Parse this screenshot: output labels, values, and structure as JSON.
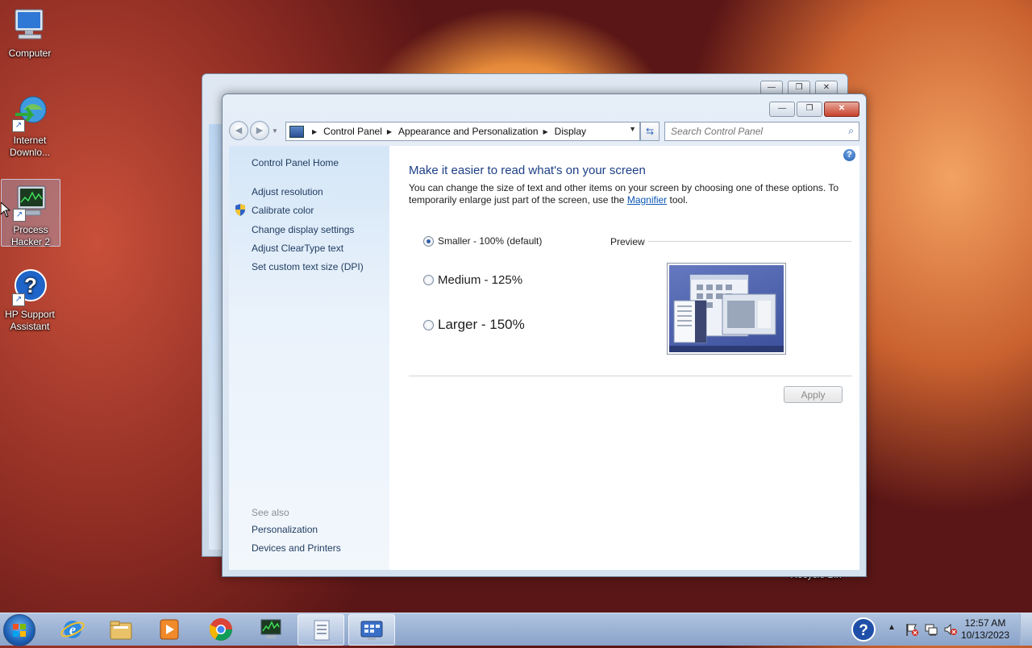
{
  "desktop": {
    "icons": [
      {
        "label": "Computer"
      },
      {
        "label": "Internet Downlo..."
      },
      {
        "label": "Process Hacker 2"
      },
      {
        "label": "HP Support Assistant"
      },
      {
        "label": "Recycle Bin"
      }
    ]
  },
  "window": {
    "caption": {
      "minimize": "—",
      "maximize": "❐",
      "close": "✕"
    },
    "address": {
      "crumbs": [
        "Control Panel",
        "Appearance and Personalization",
        "Display"
      ]
    },
    "search": {
      "placeholder": "Search Control Panel"
    },
    "left_pane": {
      "home": "Control Panel Home",
      "links": [
        "Adjust resolution",
        "Calibrate color",
        "Change display settings",
        "Adjust ClearType text",
        "Set custom text size (DPI)"
      ],
      "see_also": "See also",
      "see_also_links": [
        "Personalization",
        "Devices and Printers"
      ]
    },
    "main": {
      "title": "Make it easier to read what's on your screen",
      "desc_1": "You can change the size of text and other items on your screen by choosing one of these options. To temporarily enlarge just part of the screen, use the",
      "magnifier_link": "Magnifier",
      "desc_2": "tool.",
      "options": [
        {
          "label": "Smaller - 100% (default)",
          "checked": true
        },
        {
          "label": "Medium - 125%",
          "checked": false
        },
        {
          "label": "Larger - 150%",
          "checked": false
        }
      ],
      "preview_label": "Preview",
      "apply_label": "Apply"
    }
  },
  "taskbar": {
    "clock_time": "12:57 AM",
    "clock_date": "10/13/2023"
  },
  "colors": {
    "link": "#1e3a5f",
    "title": "#1e3f86",
    "hyperlink": "#0b56b5"
  }
}
